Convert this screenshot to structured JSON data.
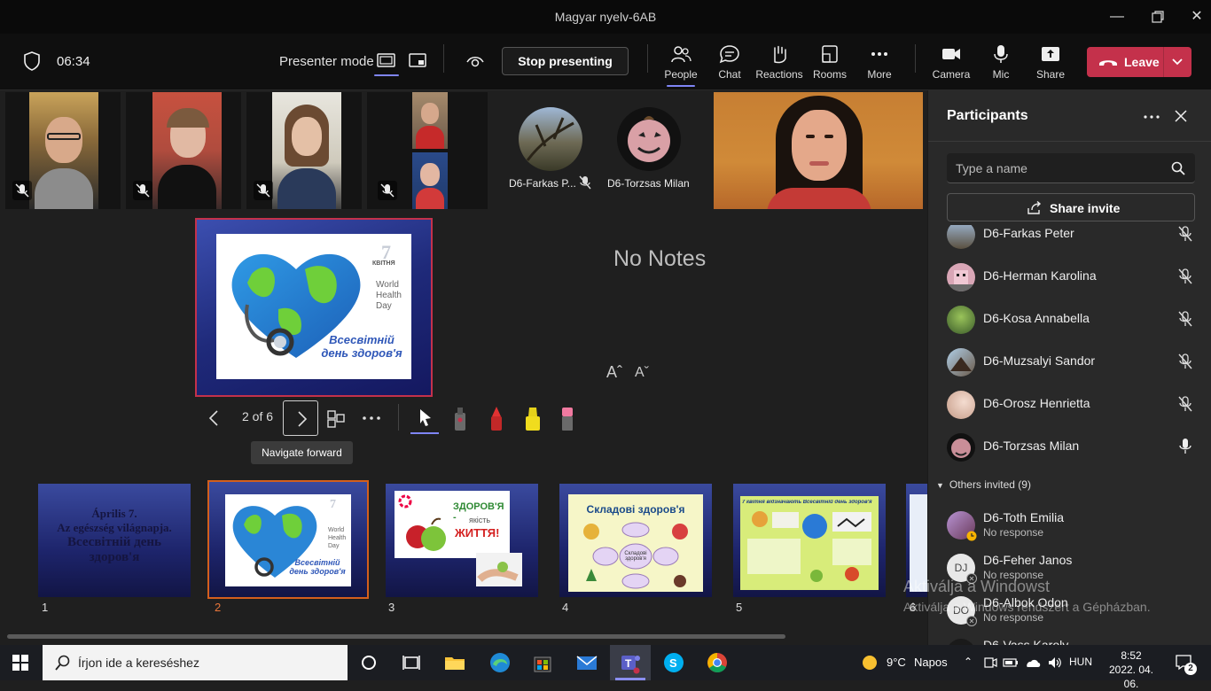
{
  "window": {
    "title": "Magyar nyelv-6AB"
  },
  "toolbar": {
    "timer": "06:34",
    "presenter_mode": "Presenter mode",
    "stop_presenting": "Stop presenting",
    "people": "People",
    "chat": "Chat",
    "reactions": "Reactions",
    "rooms": "Rooms",
    "more": "More",
    "camera": "Camera",
    "mic": "Mic",
    "share": "Share",
    "leave": "Leave"
  },
  "stage": {
    "tiles": [
      {
        "name": "D6-Farkas P..."
      },
      {
        "name": "D6-Torzsas Milan"
      }
    ],
    "main_slide": {
      "number": "7",
      "month": "КВІТНЯ",
      "line1": "World",
      "line2": "Health",
      "line3": "Day",
      "caption1": "Всесвітній",
      "caption2": "день здоров'я"
    },
    "no_notes": "No Notes",
    "font_increase": "Aˆ",
    "font_decrease": "Aˇ",
    "page_indicator": "2 of 6",
    "tooltip": "Navigate forward",
    "thumbnails": [
      {
        "num": "1",
        "lines": [
          "Április 7.",
          "Az egészség világnapja.",
          "Всесвітній день",
          "здоров'я"
        ]
      },
      {
        "num": "2"
      },
      {
        "num": "3",
        "t1": "ЗДОРОВ'Я -",
        "t2": "якість",
        "t3": "ЖИТТЯ!"
      },
      {
        "num": "4",
        "title": "Складові здоров'я",
        "center": "Складові здоров'я"
      },
      {
        "num": "5",
        "title": "7 квітня відзначають Всесвітній день здоров'я"
      },
      {
        "num": "6"
      }
    ]
  },
  "panel": {
    "title": "Participants",
    "search_placeholder": "Type a name",
    "share_invite": "Share invite",
    "participants": [
      {
        "name": "D6-Farkas Peter",
        "muted": true
      },
      {
        "name": "D6-Herman Karolina",
        "muted": true
      },
      {
        "name": "D6-Kosa Annabella",
        "muted": true
      },
      {
        "name": "D6-Muzsalyi Sandor",
        "muted": true
      },
      {
        "name": "D6-Orosz Henrietta",
        "muted": true
      },
      {
        "name": "D6-Torzsas Milan",
        "muted": false
      }
    ],
    "others_header": "Others invited (9)",
    "invited": [
      {
        "name": "D6-Toth Emilia",
        "status": "No response",
        "initials": ""
      },
      {
        "name": "D6-Feher Janos",
        "status": "No response",
        "initials": "DJ"
      },
      {
        "name": "D6-Albok Odon",
        "status": "No response",
        "initials": "DO"
      },
      {
        "name": "D6-Vass Karoly",
        "status": "",
        "initials": ""
      }
    ]
  },
  "watermark": {
    "line1": "Aktiválja a Windowst",
    "line2": "Aktiválja a Windows rendszert a Gépházban."
  },
  "taskbar": {
    "search_placeholder": "Írjon ide a kereséshez",
    "weather_temp": "9°C",
    "weather_text": "Napos",
    "lang": "HUN",
    "time": "8:52",
    "date": "2022. 04. 06.",
    "notifications": "2"
  }
}
